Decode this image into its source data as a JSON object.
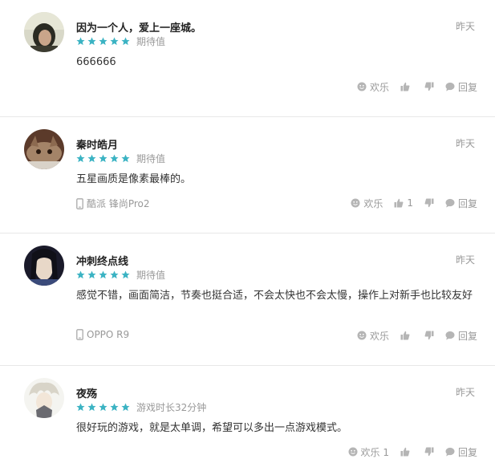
{
  "comments": [
    {
      "username": "因为一个人，爱上一座城。",
      "time": "昨天",
      "stars": 5,
      "rating_label": "期待值",
      "content": "666666",
      "device": "",
      "happy_label": "欢乐",
      "like_count": "",
      "reply_label": "回复"
    },
    {
      "username": "秦时皓月",
      "time": "昨天",
      "stars": 5,
      "rating_label": "期待值",
      "content": "五星画质是像素最棒的。",
      "device": "酷派 锋尚Pro2",
      "happy_label": "欢乐",
      "like_count": "1",
      "reply_label": "回复"
    },
    {
      "username": "冲刺终点线",
      "time": "昨天",
      "stars": 5,
      "rating_label": "期待值",
      "content": "感觉不错，画面简洁，节奏也挺合适，不会太快也不会太慢，操作上对新手也比较友好",
      "device": "OPPO R9",
      "happy_label": "欢乐",
      "like_count": "",
      "reply_label": "回复"
    },
    {
      "username": "夜殇",
      "time": "昨天",
      "stars": 5,
      "rating_label": "游戏时长32分钟",
      "content": "很好玩的游戏，就是太单调，希望可以多出一点游戏模式。",
      "device": "",
      "happy_label": "欢乐 1",
      "like_count": "",
      "reply_label": "回复"
    }
  ],
  "colors": {
    "star": "#3bb3c3",
    "muted": "#999999",
    "text": "#333333"
  }
}
